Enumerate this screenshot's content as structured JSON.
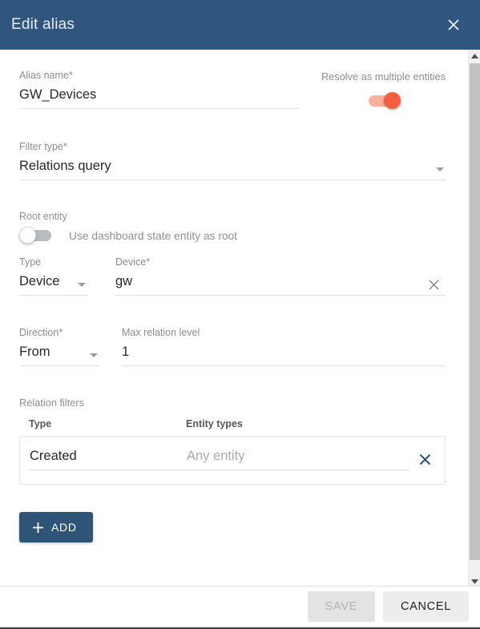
{
  "dialog": {
    "title": "Edit alias",
    "close_icon": "close-icon"
  },
  "form": {
    "alias_name": {
      "label": "Alias name",
      "required_marker": "*",
      "value": "GW_Devices"
    },
    "resolve_multiple": {
      "label": "Resolve as multiple entities",
      "state": "on"
    },
    "filter_type": {
      "label": "Filter type",
      "required_marker": "*",
      "value": "Relations query"
    },
    "root_entity": {
      "label": "Root entity",
      "use_dashboard_state_label": "Use dashboard state entity as root",
      "use_dashboard_state": "off",
      "type": {
        "label": "Type",
        "value": "Device"
      },
      "device": {
        "label": "Device",
        "required_marker": "*",
        "value": "gw",
        "clear_icon": "clear-x-icon"
      }
    },
    "direction": {
      "label": "Direction",
      "required_marker": "*",
      "value": "From"
    },
    "max_relation_level": {
      "label": "Max relation level",
      "value": "1"
    },
    "relation_filters": {
      "label": "Relation filters",
      "columns": [
        "Type",
        "Entity types"
      ],
      "rows": [
        {
          "type": "Created",
          "entity_types_value": "",
          "entity_types_placeholder": "Any entity",
          "remove_icon": "remove-x-icon"
        }
      ],
      "add_button": {
        "label": "ADD",
        "icon": "plus-icon"
      }
    }
  },
  "footer": {
    "save_label": "SAVE",
    "save_disabled": true,
    "cancel_label": "CANCEL"
  },
  "scrollbar": {
    "up_icon": "chevron-up-icon",
    "down_icon": "chevron-down-icon"
  },
  "colors": {
    "header_bg": "#305680",
    "accent_orange": "#f4603e",
    "accent_blue": "#2e5578",
    "text_label": "#8c9094",
    "text_value": "#26282b"
  }
}
